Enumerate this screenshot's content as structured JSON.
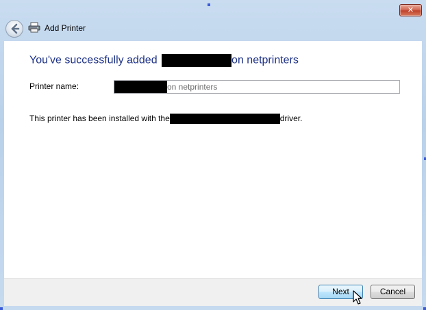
{
  "window": {
    "title": "Add Printer",
    "close_glyph": "✕"
  },
  "heading": {
    "prefix": "You've successfully added",
    "suffix": "on netprinters"
  },
  "printer_name": {
    "label": "Printer name:",
    "value_suffix": "on netprinters"
  },
  "driver": {
    "prefix": "This printer has been installed with the",
    "suffix": "driver."
  },
  "buttons": {
    "next": "Next",
    "cancel": "Cancel"
  },
  "icons": {
    "back": "back-arrow-icon",
    "printer": "printer-icon",
    "close": "close-icon",
    "cursor": "mouse-pointer-icon"
  },
  "colors": {
    "heading": "#1e3287",
    "close_button": "#c0432c",
    "default_button_border": "#3c7fb1"
  }
}
